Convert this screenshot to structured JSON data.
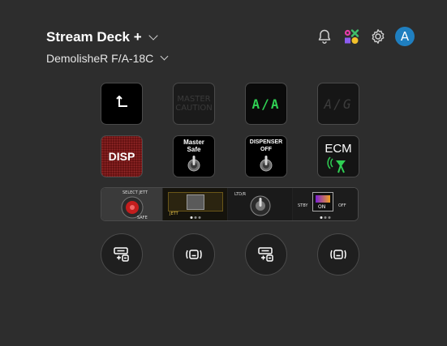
{
  "header": {
    "title": "Stream Deck +",
    "profile": "DemolisheR F/A-18C"
  },
  "top_icons": [
    "bell-icon",
    "marketplace-icon",
    "gear-icon",
    "account-avatar"
  ],
  "avatar_letter": "A",
  "keys": [
    {
      "name": "back",
      "icon": "back-arrow-icon"
    },
    {
      "name": "master-caution",
      "label": "MASTER\nCAUTION"
    },
    {
      "name": "aa",
      "label": "A/A"
    },
    {
      "name": "ag",
      "label": "A/G"
    },
    {
      "name": "disp",
      "label": "DISP"
    },
    {
      "name": "master-safe",
      "label": "Master\nSafe"
    },
    {
      "name": "dispenser-off",
      "label": "DISPENSER\nOFF"
    },
    {
      "name": "ecm",
      "label": "ECM"
    }
  ],
  "dials": [
    {
      "label": "SELECT JETT",
      "sub": "SAFE"
    },
    {
      "label": "JETT"
    },
    {
      "label": "LTD/R"
    },
    {
      "label_left": "STBY",
      "label_on": "ON",
      "label_right": "OFF"
    }
  ],
  "round_buttons": [
    "add-action-icon",
    "dial-action-icon",
    "add-action-icon",
    "dial-action-icon"
  ],
  "colors": {
    "background": "#2d2d2d",
    "avatar": "#1f7fc0",
    "aa_green": "#2fcf53"
  }
}
